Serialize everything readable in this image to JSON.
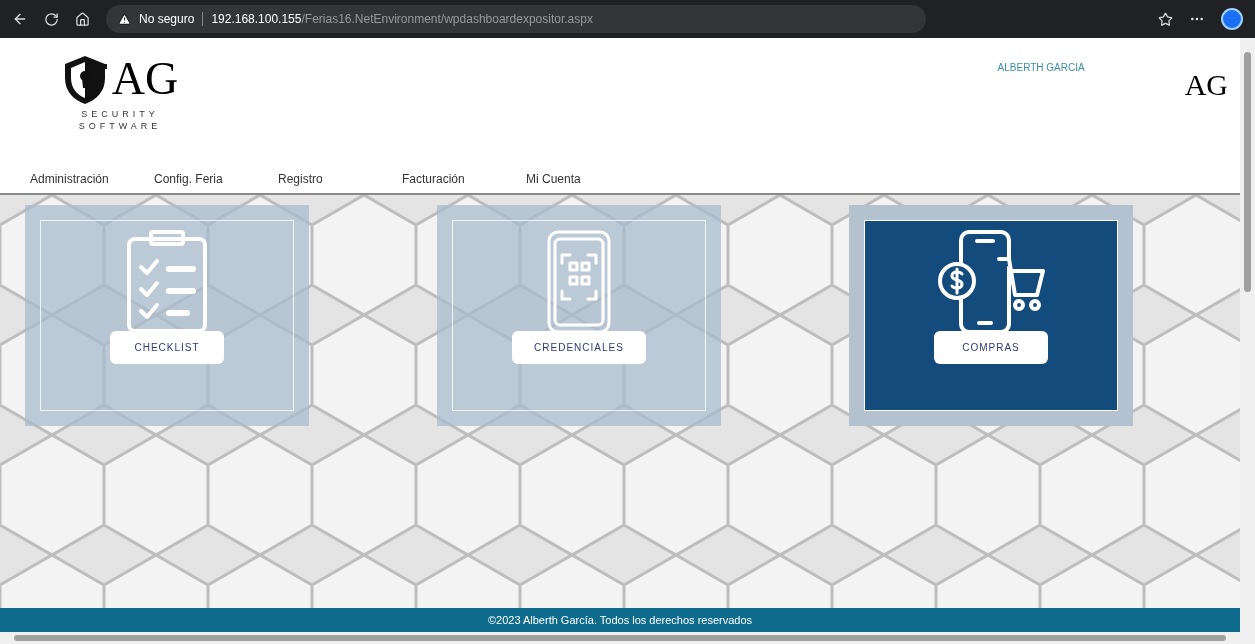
{
  "browser": {
    "security_label": "No seguro",
    "url_host": "192.168.100.155",
    "url_path": "/Ferias16.NetEnvironment/wpdashboardexpositor.aspx"
  },
  "header": {
    "logo_letters": "AG",
    "logo_line1": "SECURITY",
    "logo_line2": "SOFTWARE",
    "user_name": "ALBERTH GARCIA",
    "small_logo_letters": "AG"
  },
  "nav": [
    "Administración",
    "Config. Feria",
    "Registro",
    "Facturación",
    "Mi Cuenta"
  ],
  "cards": [
    {
      "label": "CHECKLIST",
      "kind": "checklist",
      "selected": false
    },
    {
      "label": "CREDENCIALES",
      "kind": "credentials",
      "selected": false
    },
    {
      "label": "COMPRAS",
      "kind": "purchases",
      "selected": true
    }
  ],
  "footer": "©2023 Alberth García. Todos los derechos reservados"
}
